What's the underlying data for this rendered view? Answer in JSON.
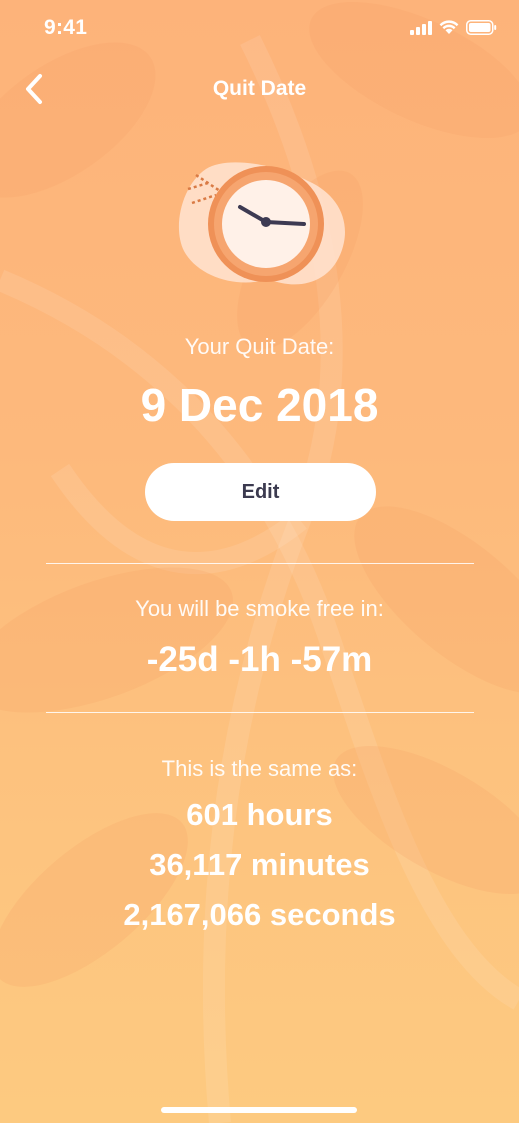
{
  "status_bar": {
    "time": "9:41",
    "icons": [
      "signal-icon",
      "wifi-icon",
      "battery-icon"
    ]
  },
  "nav": {
    "back_icon": "chevron-left-icon",
    "title": "Quit Date"
  },
  "illustration": {
    "icon": "clock-icon"
  },
  "quit": {
    "label": "Your Quit Date:",
    "date": "9 Dec 2018",
    "edit_label": "Edit"
  },
  "countdown": {
    "label": "You will be smoke free in:",
    "value": "-25d -1h -57m"
  },
  "equivalents": {
    "label": "This is the same as:",
    "items": [
      "601 hours",
      "36,117 minutes",
      "2,167,066 seconds"
    ]
  },
  "colors": {
    "background_top": "#fdb37a",
    "background_bottom": "#fdca80",
    "clock_ring": "#f0935a",
    "clock_face": "#fff1e8",
    "button_text": "#3b3a4f"
  }
}
